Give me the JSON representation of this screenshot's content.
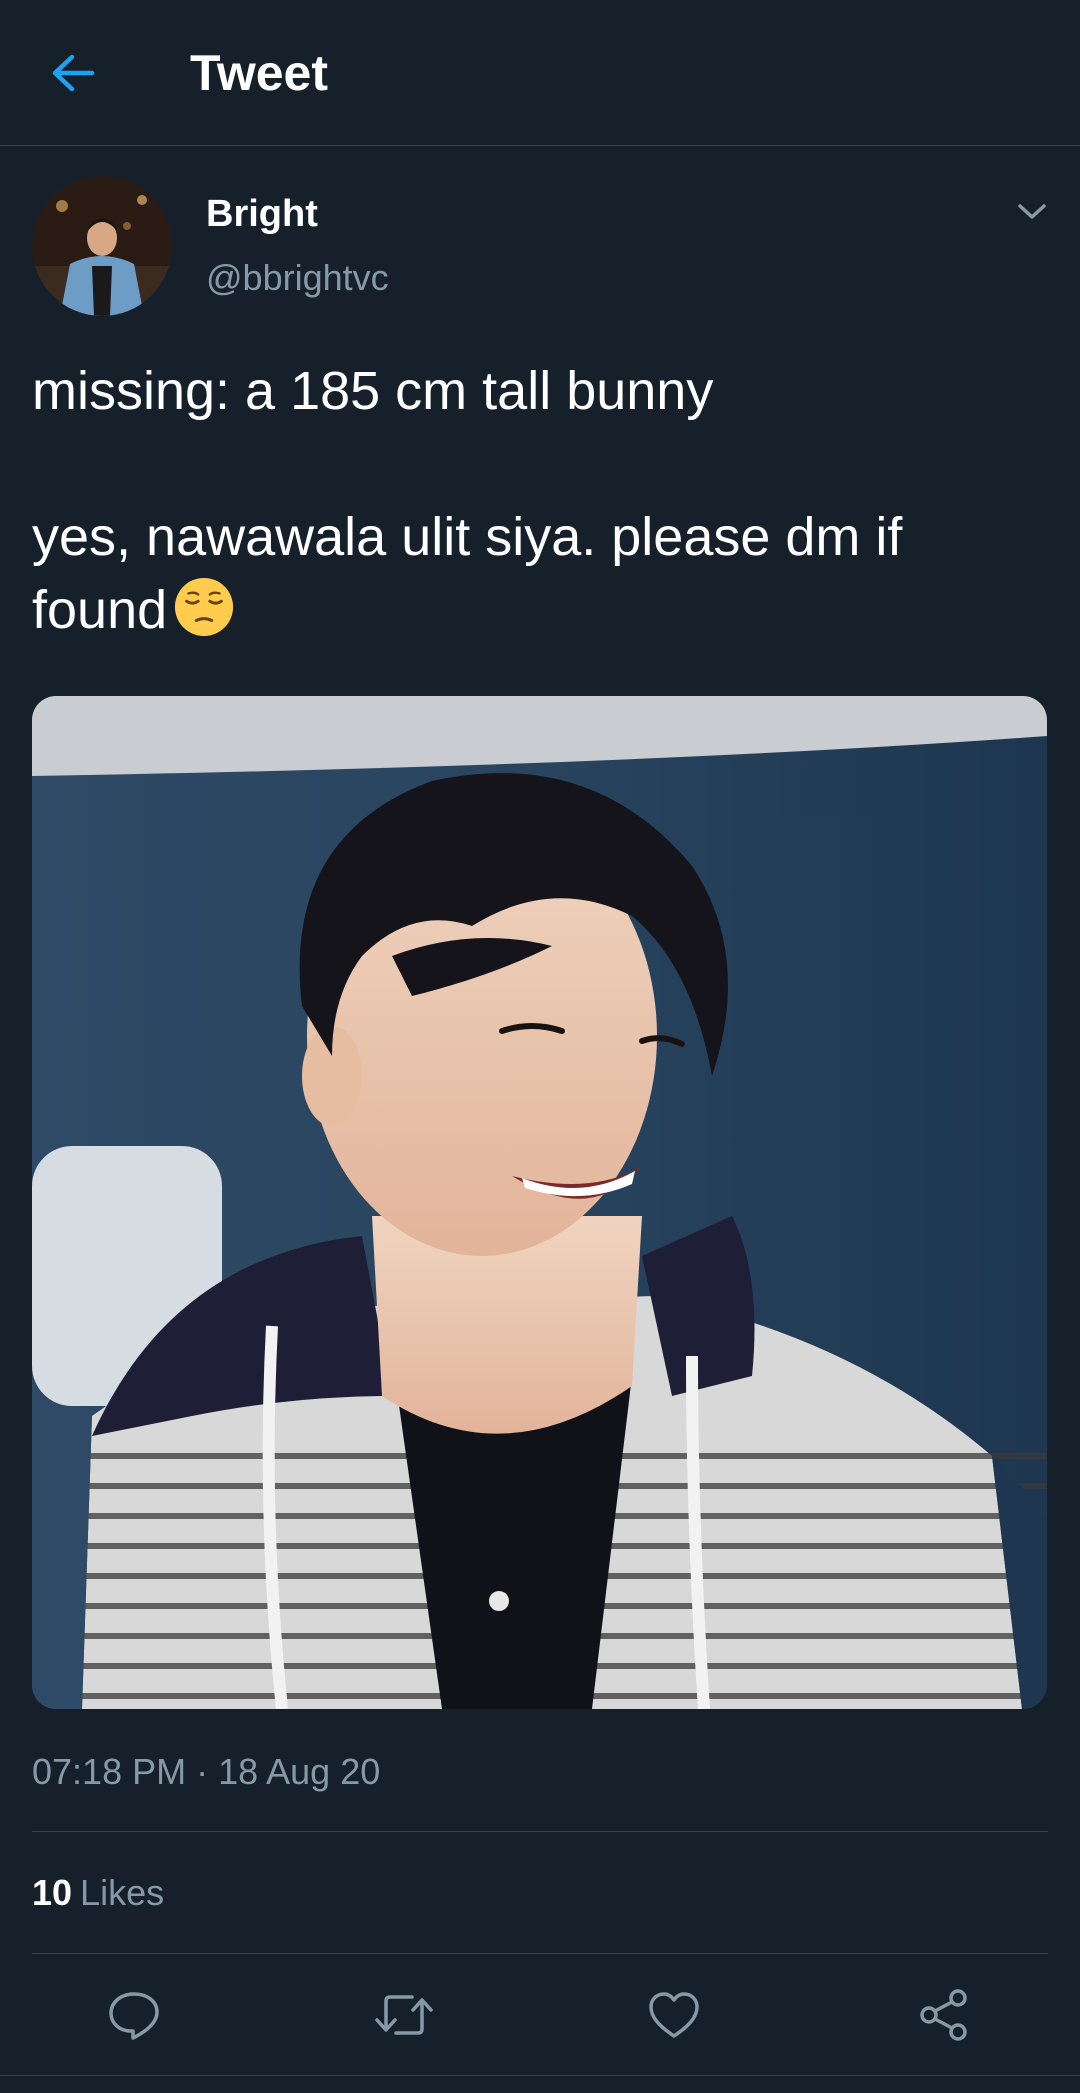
{
  "header": {
    "title": "Tweet",
    "back_icon": "arrow-left-icon"
  },
  "author": {
    "name": "Bright",
    "handle": "@bbrightvc",
    "menu_icon": "chevron-down-icon"
  },
  "tweet": {
    "line1": "missing: a 185 cm tall bunny",
    "line2": "yes, nawawala ulit siya. please dm if found",
    "emoji": "pensive-face-emoji",
    "timestamp": "07:18 PM · 18 Aug 20",
    "likes_count": "10",
    "likes_label": "Likes"
  },
  "actions": [
    {
      "icon": "reply-icon"
    },
    {
      "icon": "retweet-icon"
    },
    {
      "icon": "heart-icon"
    },
    {
      "icon": "share-icon"
    }
  ],
  "colors": {
    "background": "#15202b",
    "accent": "#1da1f2",
    "muted": "#8899a6",
    "divider": "#38444d",
    "icon": "#8899a6"
  }
}
